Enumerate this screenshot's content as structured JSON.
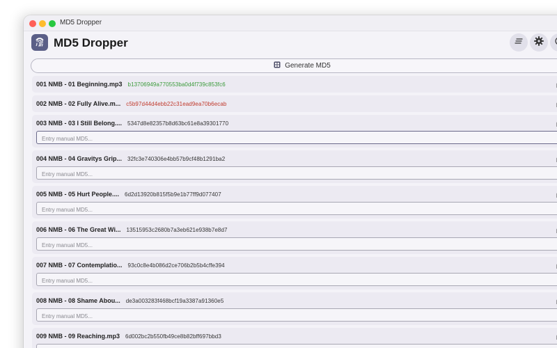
{
  "window": {
    "title": "MD5 Dropper"
  },
  "app": {
    "title": "MD5 Dropper",
    "logo_icon": "fingerprint-icon"
  },
  "toolbar": {
    "list_icon": "lines-icon",
    "settings_icon": "gear-icon"
  },
  "generate_button": {
    "label": "Generate MD5",
    "icon": "grid-icon"
  },
  "manual_placeholder": "Entry manual MD5...",
  "files": [
    {
      "name": "001 NMB - 01 Beginning.mp3",
      "hash": "b13706949a770553ba0d4f739c853fc6",
      "status": "match",
      "manual": false
    },
    {
      "name": "002 NMB - 02 Fully Alive.m...",
      "hash": "c5b97d44d4ebb22c31ead9ea70b6ecab",
      "status": "mismatch",
      "manual": false
    },
    {
      "name": "003 NMB - 03 I Still Belong....",
      "hash": "5347d8e82357b8d63bc61e8a39301770",
      "status": "none",
      "manual": true
    },
    {
      "name": "004 NMB - 04 Gravitys Grip...",
      "hash": "32fc3e740306e4bb57b9cf48b1291ba2",
      "status": "none",
      "manual": true
    },
    {
      "name": "005 NMB - 05 Hurt People....",
      "hash": "6d2d13920b815f5b9e1b77ff9d077407",
      "status": "none",
      "manual": true
    },
    {
      "name": "006 NMB - 06 The Great Wi...",
      "hash": "13515953c2680b7a3eb621e938b7e8d7",
      "status": "none",
      "manual": true
    },
    {
      "name": "007 NMB - 07 Contemplatio...",
      "hash": "93c0c8e4b086d2ce706b2b5b4cffe394",
      "status": "none",
      "manual": true
    },
    {
      "name": "008 NMB - 08 Shame Abou...",
      "hash": "de3a003283f468bcf19a3387a91360e5",
      "status": "none",
      "manual": true
    },
    {
      "name": "009 NMB - 09 Reaching.mp3",
      "hash": "6d002bc2b550fb49ce8b82bff697bbd3",
      "status": "none",
      "manual": true
    }
  ]
}
